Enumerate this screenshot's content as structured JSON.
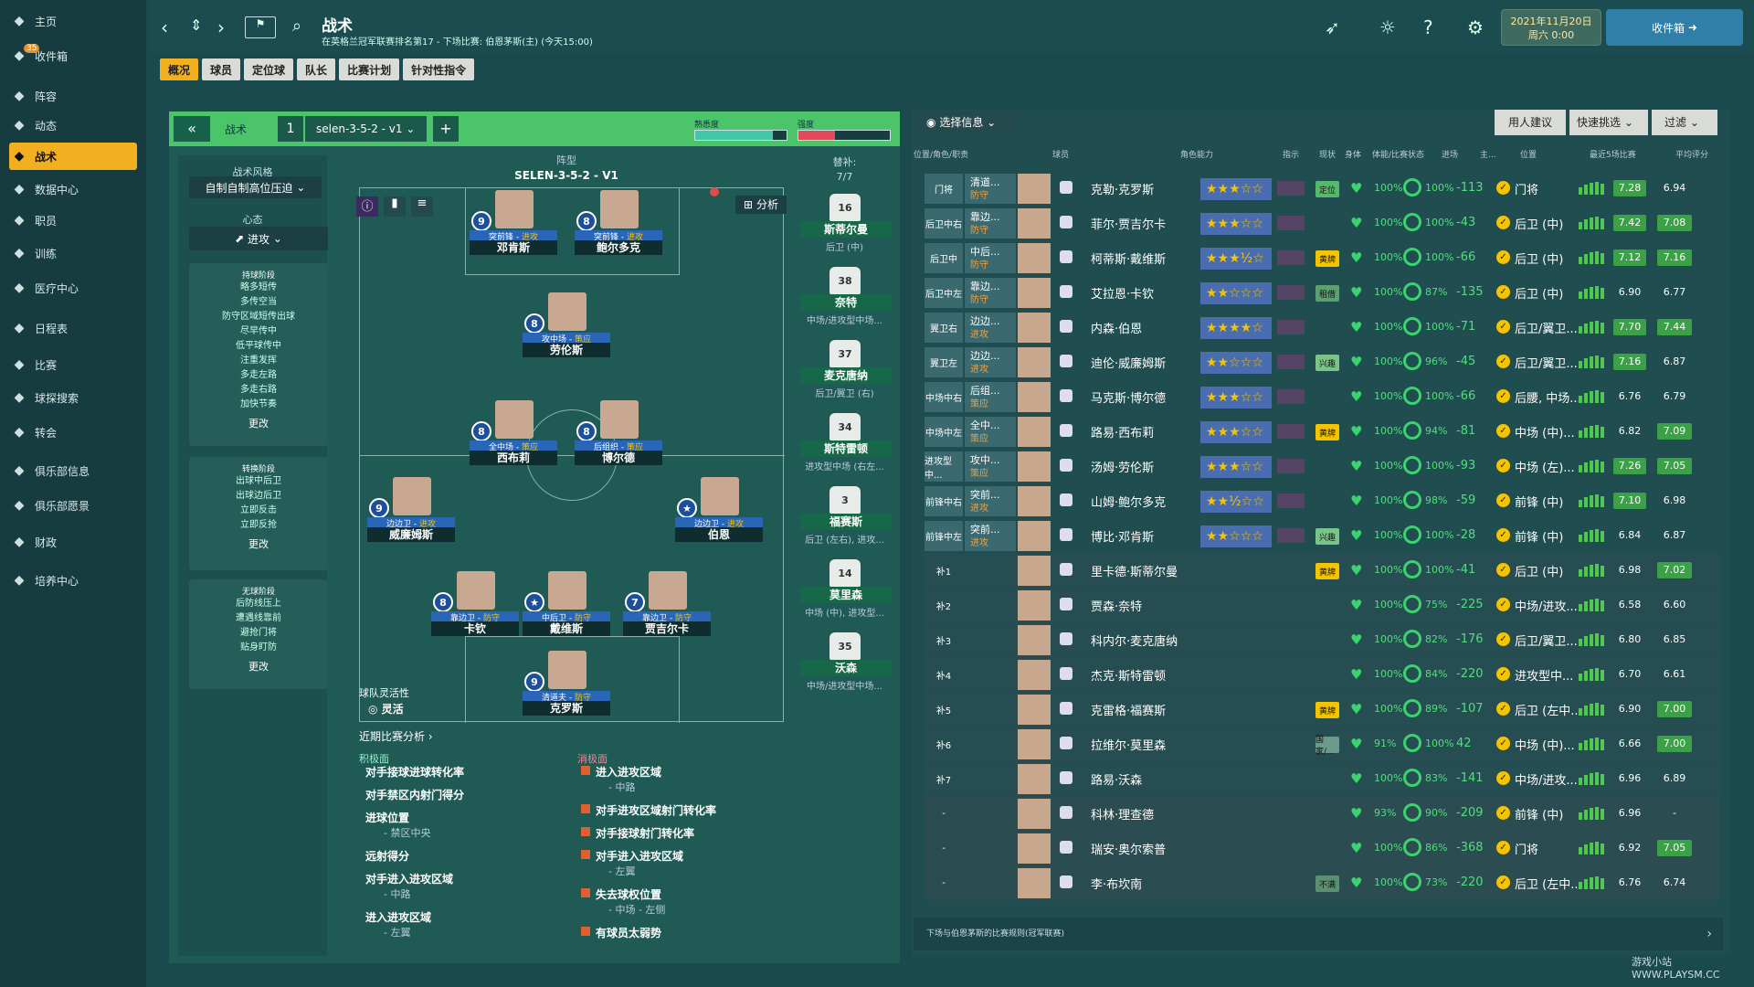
{
  "nav": {
    "items": [
      {
        "label": "主页",
        "icon": "home-icon"
      },
      {
        "label": "收件箱",
        "icon": "inbox-icon",
        "badge": "35"
      },
      {
        "label": "阵容",
        "icon": "shirt-icon"
      },
      {
        "label": "动态",
        "icon": "dynamics-icon"
      },
      {
        "label": "战术",
        "icon": "tactics-icon",
        "active": true
      },
      {
        "label": "数据中心",
        "icon": "data-icon"
      },
      {
        "label": "职员",
        "icon": "staff-icon"
      },
      {
        "label": "训练",
        "icon": "training-icon"
      },
      {
        "label": "医疗中心",
        "icon": "medical-icon"
      },
      {
        "label": "日程表",
        "icon": "calendar-icon"
      },
      {
        "label": "比赛",
        "icon": "trophy-icon"
      },
      {
        "label": "球探搜索",
        "icon": "scout-icon"
      },
      {
        "label": "转会",
        "icon": "transfer-icon"
      },
      {
        "label": "俱乐部信息",
        "icon": "shield-icon"
      },
      {
        "label": "俱乐部愿景",
        "icon": "vision-icon"
      },
      {
        "label": "财政",
        "icon": "finance-icon"
      },
      {
        "label": "培养中心",
        "icon": "development-icon"
      }
    ]
  },
  "header": {
    "title": "战术",
    "subtitle": "在英格兰冠军联赛排名第17 - 下场比赛: 伯恩茅斯(主) (今天15:00)",
    "date": "2021年11月20日",
    "day": "周六 0:00",
    "inbox": "收件箱"
  },
  "tabs": [
    "概况",
    "球员",
    "定位球",
    "队长",
    "比赛计划",
    "针对性指令"
  ],
  "tactic": {
    "label": "战术",
    "slot": "1",
    "name": "selen-3-5-2 - v1",
    "familiarity": "熟悉度",
    "intensity": "强度",
    "pitch_title": "SELEN-3-5-2 - V1",
    "analysis": "分析",
    "subs_label": "替补:",
    "subs_count": "7/7"
  },
  "style": {
    "label": "战术风格",
    "value": "自制自制高位压迫",
    "mentality_label": "心态",
    "mentality": "进攻",
    "phases": [
      {
        "title": "持球阶段",
        "items": [
          "略多短传",
          "多传空当",
          "防守区域短传出球",
          "尽早传中",
          "低平球传中",
          "注重发挥",
          "多走左路",
          "多走右路",
          "加快节奏"
        ],
        "more": "更改"
      },
      {
        "title": "转换阶段",
        "items": [
          "出球中后卫",
          "出球边后卫",
          "立即反击",
          "立即反抢"
        ],
        "more": "更改"
      },
      {
        "title": "无球阶段",
        "items": [
          "后防线压上",
          "遭遇线靠前",
          "避抢门将",
          "贴身盯防"
        ],
        "more": "更改"
      }
    ],
    "flex_label": "球队灵活性",
    "flex_value": "灵活"
  },
  "players": [
    {
      "n": "9",
      "role": "突前锋",
      "duty": "进攻",
      "name": "邓肯斯"
    },
    {
      "n": "8",
      "role": "突前锋",
      "duty": "进攻",
      "name": "鲍尔多克"
    },
    {
      "n": "8",
      "role": "攻中场",
      "duty": "策应",
      "name": "劳伦斯"
    },
    {
      "n": "8",
      "role": "全中场",
      "duty": "策应",
      "name": "西布莉"
    },
    {
      "n": "8",
      "role": "后组织",
      "duty": "策应",
      "name": "博尔德"
    },
    {
      "n": "9",
      "role": "边边卫",
      "duty": "进攻",
      "name": "威廉姆斯"
    },
    {
      "n": "★",
      "role": "边边卫",
      "duty": "进攻",
      "name": "伯恩"
    },
    {
      "n": "8",
      "role": "靠边卫",
      "duty": "防守",
      "name": "卡钦"
    },
    {
      "n": "★",
      "role": "中后卫",
      "duty": "防守",
      "name": "戴维斯"
    },
    {
      "n": "7",
      "role": "靠边卫",
      "duty": "防守",
      "name": "贾吉尔卡"
    },
    {
      "n": "9",
      "role": "清道夫",
      "duty": "防守",
      "name": "克罗斯"
    }
  ],
  "bench": [
    {
      "num": "16",
      "name": "斯蒂尔曼",
      "pos": "后卫 (中)"
    },
    {
      "num": "38",
      "name": "奈特",
      "pos": "中场/进攻型中场..."
    },
    {
      "num": "37",
      "name": "麦克唐纳",
      "pos": "后卫/翼卫 (右)"
    },
    {
      "num": "34",
      "name": "斯特雷顿",
      "pos": "进攻型中场 (右左..."
    },
    {
      "num": "3",
      "name": "福赛斯",
      "pos": "后卫 (左右), 进攻..."
    },
    {
      "num": "14",
      "name": "莫里森",
      "pos": "中场 (中), 进攻型..."
    },
    {
      "num": "35",
      "name": "沃森",
      "pos": "中场/进攻型中场..."
    }
  ],
  "analysis": {
    "title": "近期比赛分析",
    "pos_label": "积极面",
    "neg_label": "消极面",
    "positives": [
      {
        "t": "对手接球进球转化率",
        "s": ""
      },
      {
        "t": "对手禁区内射门得分",
        "s": ""
      },
      {
        "t": "进球位置",
        "s": "- 禁区中央"
      },
      {
        "t": "远射得分",
        "s": ""
      },
      {
        "t": "对手进入进攻区域",
        "s": "- 中路"
      },
      {
        "t": "进入进攻区域",
        "s": "- 左翼"
      }
    ],
    "negatives": [
      {
        "t": "进入进攻区域",
        "s": "- 中路"
      },
      {
        "t": "对手进攻区域射门转化率",
        "s": ""
      },
      {
        "t": "对手接球射门转化率",
        "s": ""
      },
      {
        "t": "对手进入进攻区域",
        "s": "- 左翼"
      },
      {
        "t": "失去球权位置",
        "s": "- 中场 - 左侧"
      },
      {
        "t": "有球员太弱势",
        "s": ""
      }
    ]
  },
  "squad": {
    "select_info": "选择信息",
    "suggest": "用人建议",
    "quick": "快速挑选",
    "filter": "过滤",
    "headers": [
      "位置/角色/职责",
      "球员",
      "角色能力",
      "指示",
      "现状",
      "身体",
      "体能/比赛状态",
      "进场",
      "主...",
      "位置",
      "最近5场比赛",
      "平均评分"
    ],
    "rows": [
      {
        "pos": "门将",
        "role": "清道...",
        "duty": "防守",
        "name": "克勒·克罗斯",
        "stars": "★★★☆☆",
        "badge": "定位",
        "cond": "100%",
        "sharp": "100%",
        "val": "-113",
        "pos2": "门将",
        "rating": "7.28",
        "avg": "6.94"
      },
      {
        "pos": "后卫中右",
        "role": "靠边...",
        "duty": "防守",
        "name": "菲尔·贾吉尔卡",
        "stars": "★★★☆☆",
        "badge": "",
        "cond": "100%",
        "sharp": "100%",
        "val": "-43",
        "pos2": "后卫 (中)",
        "rating": "7.42",
        "avg": "7.08"
      },
      {
        "pos": "后卫中",
        "role": "中后...",
        "duty": "防守",
        "name": "柯蒂斯·戴维斯",
        "stars": "★★★½☆",
        "badge": "黄牌",
        "cond": "100%",
        "sharp": "100%",
        "val": "-66",
        "pos2": "后卫 (中)",
        "rating": "7.12",
        "avg": "7.16"
      },
      {
        "pos": "后卫中左",
        "role": "靠边...",
        "duty": "防守",
        "name": "艾拉恩·卡钦",
        "stars": "★★☆☆☆",
        "badge": "租借",
        "cond": "100%",
        "sharp": "87%",
        "val": "-135",
        "pos2": "后卫 (中)",
        "rating": "6.90",
        "avg": "6.77"
      },
      {
        "pos": "翼卫右",
        "role": "边边...",
        "duty": "进攻",
        "name": "内森·伯恩",
        "stars": "★★★★☆",
        "badge": "",
        "cond": "100%",
        "sharp": "100%",
        "val": "-71",
        "pos2": "后卫/翼卫...",
        "rating": "7.70",
        "avg": "7.44"
      },
      {
        "pos": "翼卫左",
        "role": "边边...",
        "duty": "进攻",
        "name": "迪伦·威廉姆斯",
        "stars": "★★☆☆☆",
        "badge": "兴趣",
        "cond": "100%",
        "sharp": "96%",
        "val": "-45",
        "pos2": "后卫/翼卫...",
        "rating": "7.16",
        "avg": "6.87"
      },
      {
        "pos": "中场中右",
        "role": "后组...",
        "duty": "策应",
        "name": "马克斯·博尔德",
        "stars": "★★★☆☆",
        "badge": "",
        "cond": "100%",
        "sharp": "100%",
        "val": "-66",
        "pos2": "后腰, 中场...",
        "rating": "6.76",
        "avg": "6.79"
      },
      {
        "pos": "中场中左",
        "role": "全中...",
        "duty": "策应",
        "name": "路易·西布莉",
        "stars": "★★★☆☆",
        "badge": "黄牌",
        "cond": "100%",
        "sharp": "94%",
        "val": "-81",
        "pos2": "中场 (中)...",
        "rating": "6.82",
        "avg": "7.09"
      },
      {
        "pos": "进攻型中...",
        "role": "攻中...",
        "duty": "策应",
        "name": "汤姆·劳伦斯",
        "stars": "★★★☆☆",
        "badge": "",
        "cond": "100%",
        "sharp": "100%",
        "val": "-93",
        "pos2": "中场 (左)...",
        "rating": "7.26",
        "avg": "7.05"
      },
      {
        "pos": "前锋中右",
        "role": "突前...",
        "duty": "进攻",
        "name": "山姆·鲍尔多克",
        "stars": "★★½☆☆",
        "badge": "",
        "cond": "100%",
        "sharp": "98%",
        "val": "-59",
        "pos2": "前锋 (中)",
        "rating": "7.10",
        "avg": "6.98"
      },
      {
        "pos": "前锋中左",
        "role": "突前...",
        "duty": "进攻",
        "name": "博比·邓肯斯",
        "stars": "★★☆☆☆",
        "badge": "兴趣",
        "cond": "100%",
        "sharp": "100%",
        "val": "-28",
        "pos2": "前锋 (中)",
        "rating": "6.84",
        "avg": "6.87"
      },
      {
        "pos": "补1",
        "role": "",
        "duty": "",
        "name": "里卡德·斯蒂尔曼",
        "stars": "",
        "badge": "黄牌",
        "cond": "100%",
        "sharp": "100%",
        "val": "-41",
        "pos2": "后卫 (中)",
        "rating": "6.98",
        "avg": "7.02"
      },
      {
        "pos": "补2",
        "role": "",
        "duty": "",
        "name": "贾森·奈特",
        "stars": "",
        "badge": "",
        "cond": "100%",
        "sharp": "75%",
        "val": "-225",
        "pos2": "中场/进攻...",
        "rating": "6.58",
        "avg": "6.60"
      },
      {
        "pos": "补3",
        "role": "",
        "duty": "",
        "name": "科内尔·麦克唐纳",
        "stars": "",
        "badge": "",
        "cond": "100%",
        "sharp": "82%",
        "val": "-176",
        "pos2": "后卫/翼卫...",
        "rating": "6.80",
        "avg": "6.85"
      },
      {
        "pos": "补4",
        "role": "",
        "duty": "",
        "name": "杰克·斯特雷顿",
        "stars": "",
        "badge": "",
        "cond": "100%",
        "sharp": "84%",
        "val": "-220",
        "pos2": "进攻型中...",
        "rating": "6.70",
        "avg": "6.61"
      },
      {
        "pos": "补5",
        "role": "",
        "duty": "",
        "name": "克雷格·福赛斯",
        "stars": "",
        "badge": "黄牌",
        "cond": "100%",
        "sharp": "89%",
        "val": "-107",
        "pos2": "后卫 (左中...",
        "rating": "6.90",
        "avg": "7.00"
      },
      {
        "pos": "补6",
        "role": "",
        "duty": "",
        "name": "拉维尔·莫里森",
        "stars": "",
        "badge": "国家/...",
        "cond": "91%",
        "sharp": "100%",
        "val": "42",
        "pos2": "中场 (中)...",
        "rating": "6.66",
        "avg": "7.00"
      },
      {
        "pos": "补7",
        "role": "",
        "duty": "",
        "name": "路易·沃森",
        "stars": "",
        "badge": "",
        "cond": "100%",
        "sharp": "83%",
        "val": "-141",
        "pos2": "中场/进攻...",
        "rating": "6.96",
        "avg": "6.89"
      },
      {
        "pos": "-",
        "role": "",
        "duty": "",
        "name": "科林·理查德",
        "stars": "",
        "badge": "",
        "cond": "93%",
        "sharp": "90%",
        "val": "-209",
        "pos2": "前锋 (中)",
        "rating": "6.96",
        "avg": "-"
      },
      {
        "pos": "-",
        "role": "",
        "duty": "",
        "name": "瑞安·奥尔索普",
        "stars": "",
        "badge": "",
        "cond": "100%",
        "sharp": "86%",
        "val": "-368",
        "pos2": "门将",
        "rating": "6.92",
        "avg": "7.05"
      },
      {
        "pos": "-",
        "role": "",
        "duty": "",
        "name": "李·布坎南",
        "stars": "",
        "badge": "不满",
        "cond": "100%",
        "sharp": "73%",
        "val": "-220",
        "pos2": "后卫 (左中...",
        "rating": "6.76",
        "avg": "6.74"
      }
    ],
    "footer": "下场与伯恩茅斯的比赛规则(冠军联赛)"
  },
  "watermark": "游戏小站 WWW.PLAYSM.CC"
}
